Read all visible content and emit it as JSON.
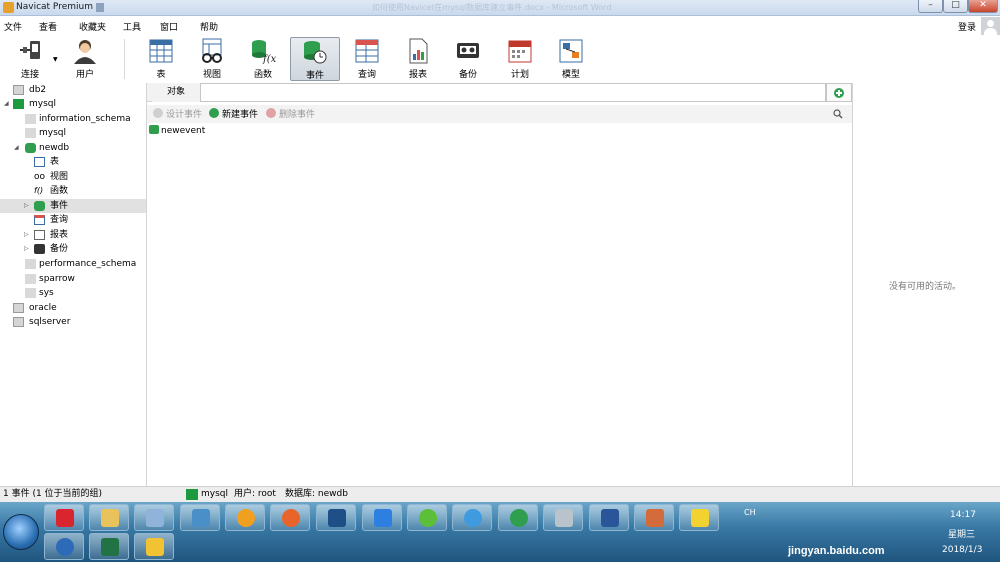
{
  "window": {
    "title": "Navicat Premium",
    "doc_title": "如何使用Navicat在mysql数据库建立事件.docx - Microsoft Word",
    "minimize": "–",
    "maximize": "□",
    "close": "✕"
  },
  "menu": {
    "items": [
      "文件",
      "查看",
      "收藏夹",
      "工具",
      "窗口",
      "帮助"
    ],
    "login": "登录"
  },
  "toolbar": {
    "items": [
      {
        "label": "连接",
        "icon": "plug-icon"
      },
      {
        "label": "用户",
        "icon": "user-icon"
      },
      {
        "label": "表",
        "icon": "table-icon"
      },
      {
        "label": "视图",
        "icon": "view-icon"
      },
      {
        "label": "函数",
        "icon": "function-icon"
      },
      {
        "label": "事件",
        "icon": "event-icon"
      },
      {
        "label": "查询",
        "icon": "query-icon"
      },
      {
        "label": "报表",
        "icon": "report-icon"
      },
      {
        "label": "备份",
        "icon": "backup-icon"
      },
      {
        "label": "计划",
        "icon": "schedule-icon"
      },
      {
        "label": "模型",
        "icon": "model-icon"
      }
    ],
    "active": "事件"
  },
  "tree": [
    {
      "label": "db2",
      "level": 0
    },
    {
      "label": "mysql",
      "level": 0
    },
    {
      "label": "information_schema",
      "level": 1
    },
    {
      "label": "mysql",
      "level": 1
    },
    {
      "label": "newdb",
      "level": 1
    },
    {
      "label": "表",
      "level": 2
    },
    {
      "label": "视图",
      "level": 2
    },
    {
      "label": "函数",
      "level": 2
    },
    {
      "label": "事件",
      "level": 2
    },
    {
      "label": "查询",
      "level": 2
    },
    {
      "label": "报表",
      "level": 2
    },
    {
      "label": "备份",
      "level": 2
    },
    {
      "label": "performance_schema",
      "level": 1
    },
    {
      "label": "sparrow",
      "level": 1
    },
    {
      "label": "sys",
      "level": 1
    },
    {
      "label": "oracle",
      "level": 0
    },
    {
      "label": "sqlserver",
      "level": 0
    }
  ],
  "center": {
    "tab": "对象",
    "search_value": "",
    "buttons": {
      "design": "设计事件",
      "new": "新建事件",
      "delete": "删除事件"
    },
    "items": [
      "newevent"
    ]
  },
  "right": {
    "no_activity": "没有可用的活动。"
  },
  "status": {
    "count": "1 事件 (1 位于当前的组)",
    "connection": "mysql",
    "user": "用户: root",
    "database": "数据库: newdb"
  },
  "taskbar": {
    "lang": "CH",
    "time": "14:17",
    "day": "星期三",
    "date": "2018/1/3",
    "watermark": "jingyan.baidu.com"
  },
  "colors": {
    "event_active_bg": "#cfd6de",
    "mysql_green": "#1d9a3e",
    "taskbar_top": "#6aa6c9",
    "taskbar_bottom": "#1f557e"
  }
}
